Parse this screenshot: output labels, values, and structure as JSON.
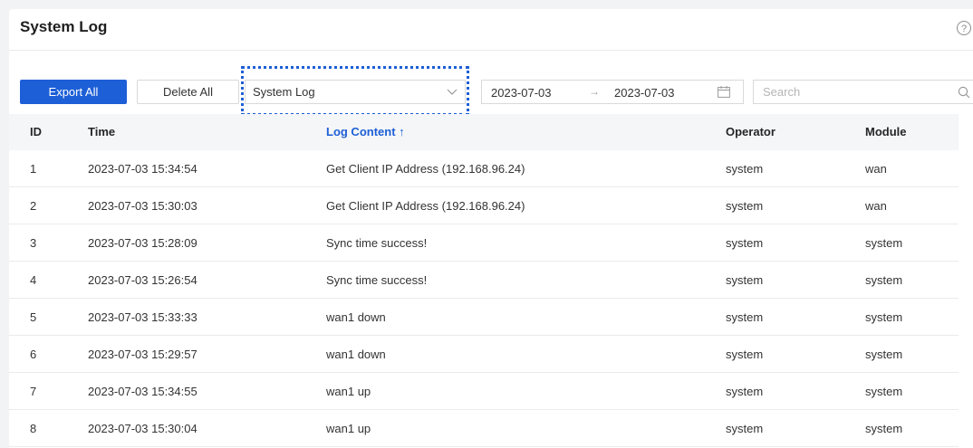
{
  "page": {
    "title": "System Log",
    "help_glyph": "?"
  },
  "toolbar": {
    "export_label": "Export All",
    "delete_label": "Delete All",
    "log_type_selected": "System Log",
    "date_start": "2023-07-03",
    "date_separator": "→",
    "date_end": "2023-07-03",
    "search_placeholder": "Search"
  },
  "table": {
    "columns": [
      "ID",
      "Time",
      "Log Content ↑",
      "Operator",
      "Module"
    ],
    "sorted_column": "Log Content",
    "rows": [
      {
        "id": "1",
        "time": "2023-07-03 15:34:54",
        "content": "Get Client IP Address (192.168.96.24)",
        "operator": "system",
        "module": "wan"
      },
      {
        "id": "2",
        "time": "2023-07-03 15:30:03",
        "content": "Get Client IP Address (192.168.96.24)",
        "operator": "system",
        "module": "wan"
      },
      {
        "id": "3",
        "time": "2023-07-03 15:28:09",
        "content": "Sync time success!",
        "operator": "system",
        "module": "system"
      },
      {
        "id": "4",
        "time": "2023-07-03 15:26:54",
        "content": "Sync time success!",
        "operator": "system",
        "module": "system"
      },
      {
        "id": "5",
        "time": "2023-07-03 15:33:33",
        "content": "wan1 down",
        "operator": "system",
        "module": "system"
      },
      {
        "id": "6",
        "time": "2023-07-03 15:29:57",
        "content": "wan1 down",
        "operator": "system",
        "module": "system"
      },
      {
        "id": "7",
        "time": "2023-07-03 15:34:55",
        "content": "wan1 up",
        "operator": "system",
        "module": "system"
      },
      {
        "id": "8",
        "time": "2023-07-03 15:30:04",
        "content": "wan1 up",
        "operator": "system",
        "module": "system"
      }
    ]
  },
  "colors": {
    "accent": "#1d5fd6",
    "header_bg": "#f5f6f8",
    "border": "#ebebeb"
  },
  "icons": [
    "help-icon",
    "chevron-down-icon",
    "calendar-icon",
    "search-icon"
  ]
}
